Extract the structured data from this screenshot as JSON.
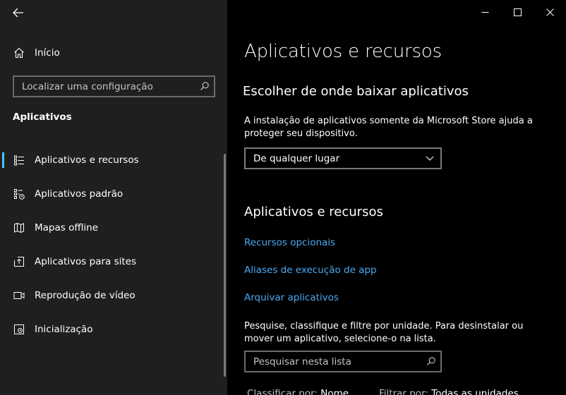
{
  "sidebar": {
    "home_label": "Início",
    "search_placeholder": "Localizar uma configuração",
    "section_title": "Aplicativos",
    "items": [
      {
        "label": "Aplicativos e recursos",
        "icon": "apps-list-icon",
        "active": true
      },
      {
        "label": "Aplicativos padrão",
        "icon": "default-apps-icon",
        "active": false
      },
      {
        "label": "Mapas offline",
        "icon": "map-icon",
        "active": false
      },
      {
        "label": "Aplicativos para sites",
        "icon": "open-in-app-icon",
        "active": false
      },
      {
        "label": "Reprodução de vídeo",
        "icon": "video-icon",
        "active": false
      },
      {
        "label": "Inicialização",
        "icon": "startup-icon",
        "active": false
      }
    ]
  },
  "window": {
    "controls": [
      "minimize-icon",
      "maximize-icon",
      "close-icon"
    ]
  },
  "main": {
    "title": "Aplicativos e recursos",
    "download_heading": "Escolher de onde baixar aplicativos",
    "download_description": "A instalação de aplicativos somente da Microsoft Store ajuda a proteger seu dispositivo.",
    "source_selected": "De qualquer lugar",
    "apps_heading": "Aplicativos e recursos",
    "links": {
      "optional": "Recursos opcionais",
      "aliases": "Aliases de execução de app",
      "archive": "Arquivar aplicativos"
    },
    "search_description": "Pesquise, classifique e filtre por unidade. Para desinstalar ou mover um aplicativo, selecione-o na lista.",
    "list_search_placeholder": "Pesquisar nesta lista",
    "sort_label": "Classificar por:",
    "sort_value": "Nome",
    "filter_label": "Filtrar por:",
    "filter_value": "Todas as unidades"
  },
  "colors": {
    "sidebar_bg": "#1f1f1f",
    "content_bg": "#000000",
    "accent": "#4cc2ff",
    "link": "#4aa8f0"
  }
}
